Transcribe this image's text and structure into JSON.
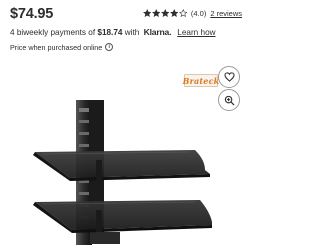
{
  "product": {
    "price": "$74.95",
    "rating": {
      "stars": 4.0,
      "value_label": "(4.0)",
      "reviews_label": "2 reviews"
    },
    "financing": {
      "prefix": "4 biweekly payments of ",
      "amount": "$18.74",
      "middle": " with ",
      "provider": "Klarna.",
      "link_label": "Learn how"
    },
    "price_note": "Price when purchased online",
    "brand_logo": "Brateck"
  },
  "icons": {
    "favorite": "heart-icon",
    "zoom": "zoom-in-icon",
    "info": "info-icon",
    "star": "star-icon"
  },
  "colors": {
    "star": "#2e2e2e",
    "brand": "#e0771c",
    "glass": "#2a2a2a"
  }
}
